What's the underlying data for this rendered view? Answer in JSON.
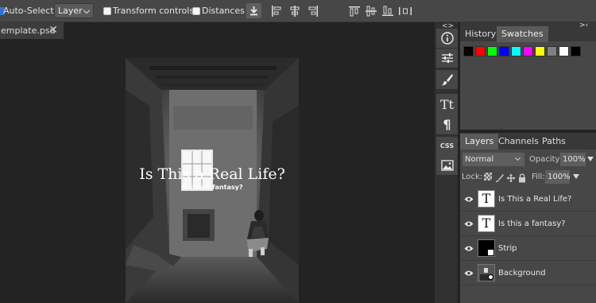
{
  "options_bar": {
    "auto_select_label": "Auto-Select",
    "layer_select_value": "Layer",
    "transform_controls_label": "Transform controls",
    "distances_label": "Distances",
    "tool_icons": [
      "download-icon",
      "align-left-icon",
      "align-center-h-icon",
      "align-right-icon",
      "align-top-icon",
      "align-middle-v-icon",
      "align-bottom-icon",
      "distribute-icon"
    ]
  },
  "document_tab": {
    "title": "emplate.psd",
    "close_glyph": "✕"
  },
  "canvas": {
    "headline": "Is This a Real Life?",
    "subline": "Is this a fantasy?"
  },
  "toolstrip": {
    "collapse_glyph": "<>",
    "css_label": "CSS",
    "text_tool_label": "Tt",
    "paragraph_glyph": "¶",
    "icons": [
      "info-icon",
      "sliders-icon",
      "brush-icon",
      "text-icon",
      "paragraph-icon",
      "css-icon",
      "image-icon"
    ]
  },
  "top_panel": {
    "collapse_glyph": ">‹",
    "tabs": [
      "History",
      "Swatches"
    ],
    "active_tab": "Swatches",
    "swatches": [
      "#000000",
      "#ff0000",
      "#00ff00",
      "#0000ff",
      "#00ffff",
      "#ff00ff",
      "#ffff00",
      "#808080",
      "#ffffff",
      "#000000"
    ]
  },
  "layers_panel": {
    "tabs": [
      "Layers",
      "Channels",
      "Paths"
    ],
    "active_tab": "Layers",
    "blend_mode": "Normal",
    "opacity_label": "Opacity:",
    "opacity_value": "100%",
    "lock_label": "Lock:",
    "fill_label": "Fill:",
    "fill_value": "100%",
    "layers": [
      {
        "name": "Is This a Real Life?",
        "kind": "text",
        "thumb_glyph": "T"
      },
      {
        "name": "Is this a fantasy?",
        "kind": "text",
        "thumb_glyph": "T"
      },
      {
        "name": "Strip",
        "kind": "mask",
        "thumb_glyph": ""
      },
      {
        "name": "Background",
        "kind": "image",
        "thumb_glyph": ""
      }
    ]
  }
}
